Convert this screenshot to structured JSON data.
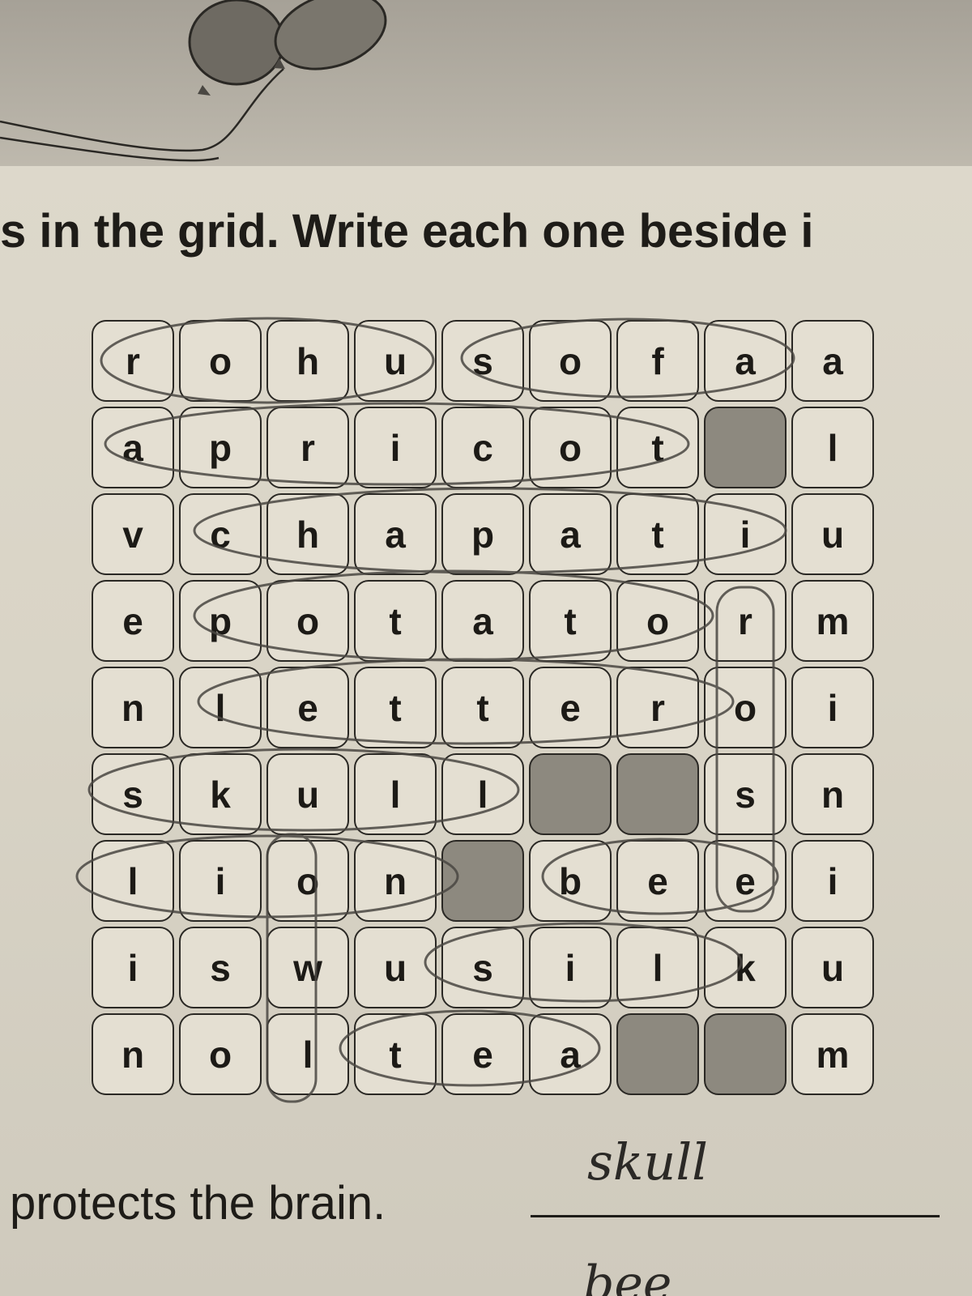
{
  "instruction": "s in the grid. Write each one beside i",
  "grid": {
    "rows": [
      [
        "r",
        "o",
        "h",
        "u",
        "s",
        "o",
        "f",
        "a",
        "a"
      ],
      [
        "a",
        "p",
        "r",
        "i",
        "c",
        "o",
        "t",
        "",
        "l"
      ],
      [
        "v",
        "c",
        "h",
        "a",
        "p",
        "a",
        "t",
        "i",
        "u"
      ],
      [
        "e",
        "p",
        "o",
        "t",
        "a",
        "t",
        "o",
        "r",
        "m"
      ],
      [
        "n",
        "l",
        "e",
        "t",
        "t",
        "e",
        "r",
        "o",
        "i"
      ],
      [
        "s",
        "k",
        "u",
        "l",
        "l",
        "",
        "",
        "s",
        "n"
      ],
      [
        "l",
        "i",
        "o",
        "n",
        "",
        "b",
        "e",
        "e",
        "i"
      ],
      [
        "i",
        "s",
        "w",
        "u",
        "s",
        "i",
        "l",
        "k",
        "u"
      ],
      [
        "n",
        "o",
        "l",
        "t",
        "e",
        "a",
        "",
        "",
        "m"
      ]
    ]
  },
  "clue": {
    "text": "protects the brain.",
    "answer": "skull",
    "next_answer": "bee"
  },
  "colors": {
    "paper": "#d9d4c6",
    "cell": "#e4dfd2",
    "blank_cell": "#8d897f",
    "ink": "#1e1c18",
    "pencil": "#4a4742"
  }
}
